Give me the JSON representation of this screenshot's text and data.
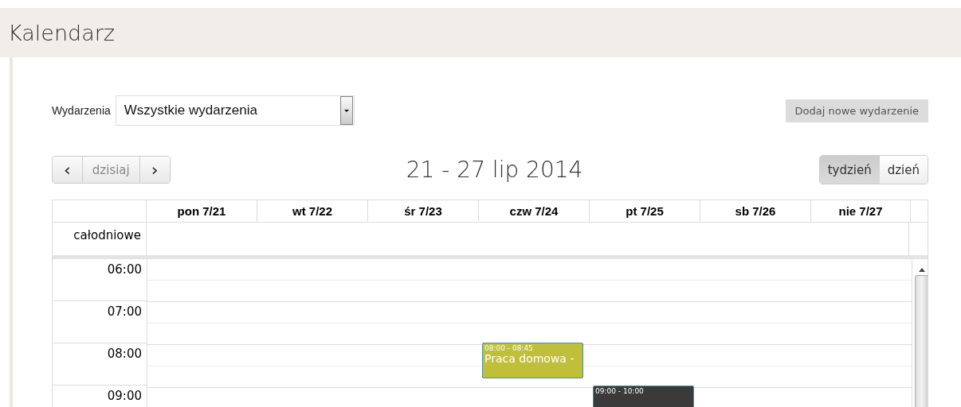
{
  "page_title": "Kalendarz",
  "filter": {
    "label": "Wydarzenia",
    "value": "Wszystkie wydarzenia"
  },
  "add_button": "Dodaj nowe wydarzenie",
  "nav": {
    "prev": "‹",
    "today": "dzisiaj",
    "next": "›"
  },
  "range_title": "21 - 27 lip 2014",
  "views": [
    {
      "label": "tydzień",
      "selected": true
    },
    {
      "label": "dzień",
      "selected": false
    }
  ],
  "all_day_label": "całodniowe",
  "days": [
    {
      "label": "pon 7/21"
    },
    {
      "label": "wt 7/22"
    },
    {
      "label": "śr 7/23"
    },
    {
      "label": "czw 7/24",
      "events": [
        {
          "time": "08:00 - 08:45",
          "title": "Praca domowa -",
          "color": "#c0bf3a"
        }
      ]
    },
    {
      "label": "pt 7/25",
      "events": [
        {
          "time": "09:00 - 10:00",
          "color": "#3a3a3a"
        }
      ]
    },
    {
      "label": "sb 7/26"
    },
    {
      "label": "nie 7/27"
    }
  ],
  "hours": [
    "06:00",
    "07:00",
    "08:00",
    "09:00"
  ]
}
